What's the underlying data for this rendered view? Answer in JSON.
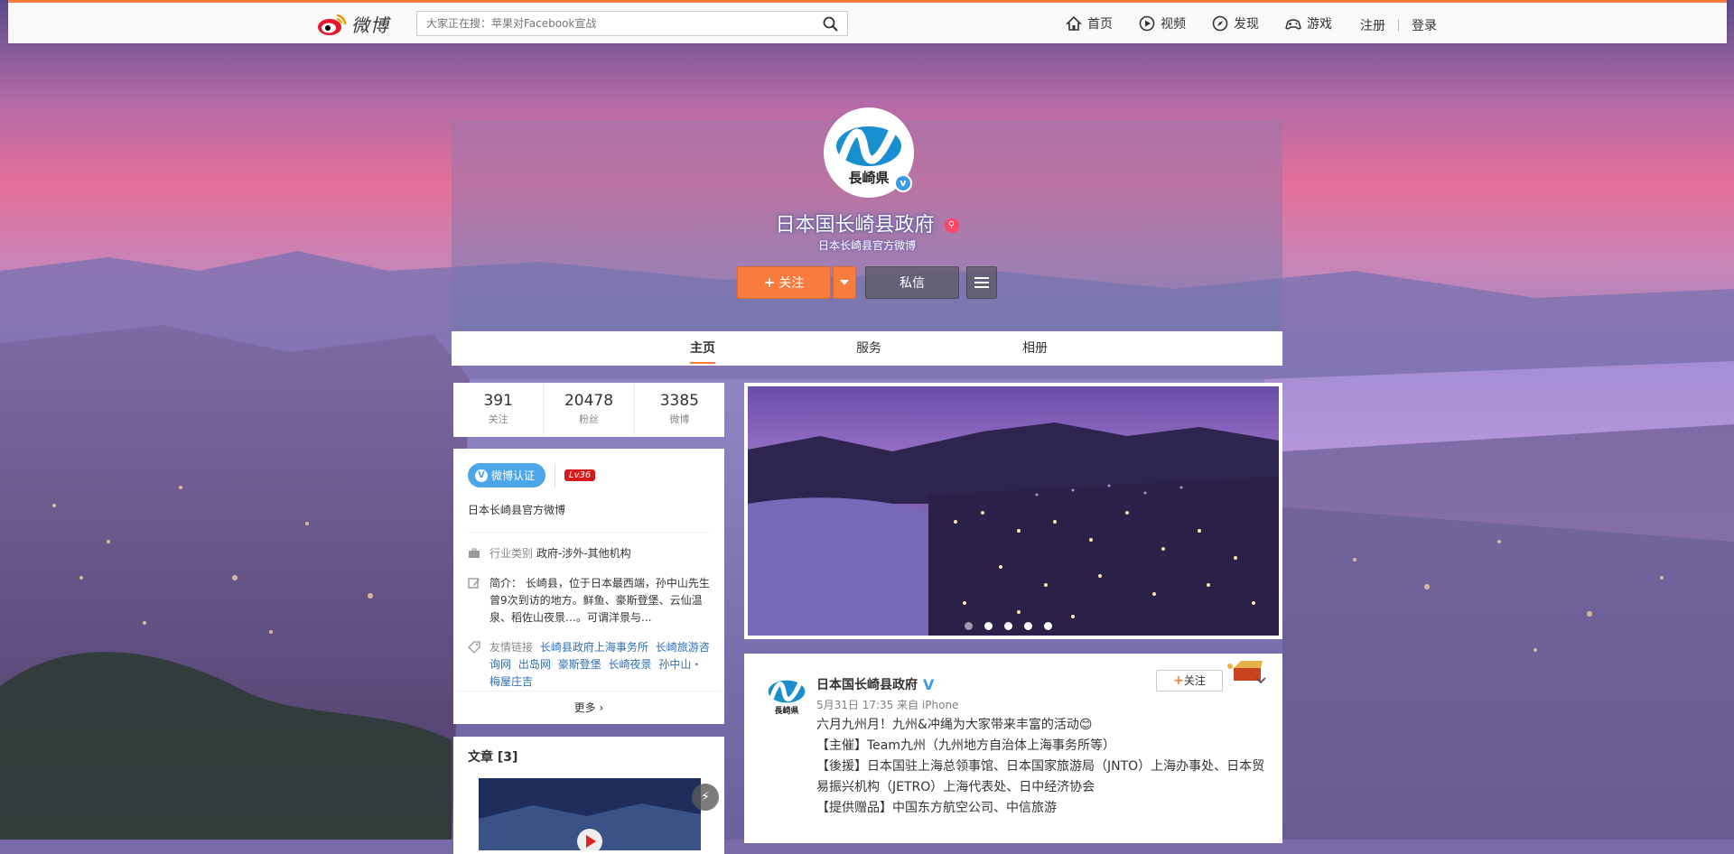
{
  "topbar": {
    "logo_text": "微博",
    "search_placeholder": "大家正在搜：苹果对Facebook宣战",
    "nav": [
      {
        "label": "首页",
        "icon": "home-icon"
      },
      {
        "label": "视频",
        "icon": "video-icon"
      },
      {
        "label": "发现",
        "icon": "compass-icon"
      },
      {
        "label": "游戏",
        "icon": "gamepad-icon"
      }
    ],
    "register": "注册",
    "login": "登录"
  },
  "profile": {
    "avatar_caption": "長崎県",
    "name": "日本国长崎县政府",
    "description": "日本长崎县官方微博",
    "follow_label": "关注",
    "message_label": "私信"
  },
  "tabs": [
    "主页",
    "服务",
    "相册"
  ],
  "stats": [
    {
      "value": "391",
      "label": "关注"
    },
    {
      "value": "20478",
      "label": "粉丝"
    },
    {
      "value": "3385",
      "label": "微博"
    }
  ],
  "info": {
    "verify_badge": "微博认证",
    "level": "Lv36",
    "verify_text": "日本长崎县官方微博",
    "industry_key": "行业类别",
    "industry_value": "政府-涉外-其他机构",
    "intro_key": "简介：",
    "intro_value": "长崎县，位于日本最西端，孙中山先生曾9次到访的地方。鲜鱼、豪斯登堡、云仙温泉、稻佐山夜景…。可谓洋景与...",
    "links_key": "友情链接",
    "links": [
      "长崎县政府上海事务所",
      "长崎旅游咨询网",
      "出岛网",
      "豪斯登堡",
      "长崎夜景",
      "孙中山・梅屋庄吉"
    ],
    "more": "更多"
  },
  "articles": {
    "title": "文章",
    "count": "[3]"
  },
  "post": {
    "author": "日本国长崎县政府",
    "avatar_caption": "長崎県",
    "time": "5月31日 17:35 来自 iPhone",
    "follow_label": "关注",
    "lines": [
      "六月九州月！九州&冲绳为大家带来丰富的活动😊",
      "【主催】Team九州（九州地方自治体上海事务所等）",
      "【後援】日本国驻上海总领事馆、日本国家旅游局（JNTO）上海办事处、日本贸易振兴机构（JETRO）上海代表处、日中经济协会",
      "【提供赠品】中国东方航空公司、中信旅游"
    ]
  },
  "colors": {
    "accent": "#fa7d3c",
    "verify_blue": "#4ba6ea",
    "level_red": "#d51a1a",
    "link_blue": "#2f6eb4"
  }
}
